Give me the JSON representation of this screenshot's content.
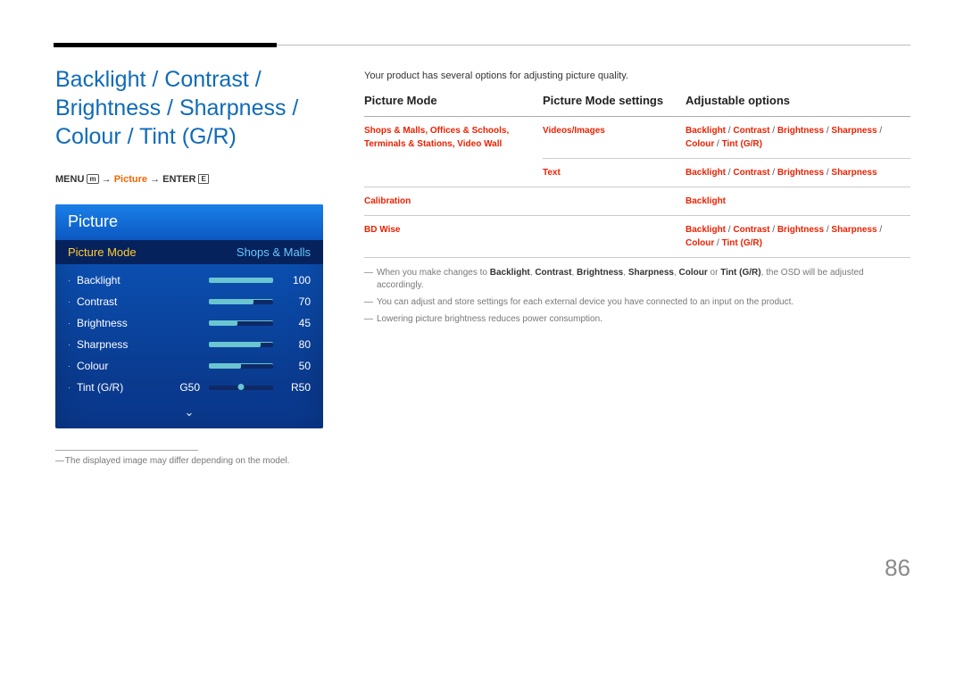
{
  "heading": "Backlight / Contrast / Brightness / Sharpness / Colour / Tint (G/R)",
  "path": {
    "menu": "MENU",
    "arrow": "→",
    "picture": "Picture",
    "enter": "ENTER",
    "menu_icon": "m",
    "enter_icon": "E"
  },
  "osd": {
    "title": "Picture",
    "mode_label": "Picture Mode",
    "mode_value": "Shops & Malls",
    "rows": [
      {
        "name": "Backlight",
        "value": "100",
        "pct": "p100"
      },
      {
        "name": "Contrast",
        "value": "70",
        "pct": "p70"
      },
      {
        "name": "Brightness",
        "value": "45",
        "pct": "p45"
      },
      {
        "name": "Sharpness",
        "value": "80",
        "pct": "p80"
      },
      {
        "name": "Colour",
        "value": "50",
        "pct": "p50"
      }
    ],
    "tint": {
      "name": "Tint (G/R)",
      "g": "G50",
      "r": "R50"
    },
    "more": "⌄"
  },
  "footnote_left": "The displayed image may differ depending on the model.",
  "intro": "Your product has several options for adjusting picture quality.",
  "columns": {
    "c1": "Picture Mode",
    "c2": "Picture Mode settings",
    "c3": "Adjustable options"
  },
  "table": [
    {
      "mode": "Shops & Malls, Offices & Schools, Terminals & Stations, Video Wall",
      "settings": "Videos/Images",
      "options": [
        "Backlight",
        "Contrast",
        "Brightness",
        "Sharpness",
        "Colour",
        "Tint (G/R)"
      ]
    },
    {
      "mode": "",
      "settings": "Text",
      "options": [
        "Backlight",
        "Contrast",
        "Brightness",
        "Sharpness"
      ]
    },
    {
      "mode": "Calibration",
      "settings": "",
      "options": [
        "Backlight"
      ]
    },
    {
      "mode": "BD Wise",
      "settings": "",
      "options": [
        "Backlight",
        "Contrast",
        "Brightness",
        "Sharpness",
        "Colour",
        "Tint (G/R)"
      ]
    }
  ],
  "notes": {
    "n1a": "When you make changes to ",
    "n1_bold": [
      "Backlight",
      "Contrast",
      "Brightness",
      "Sharpness",
      "Colour",
      "Tint (G/R)"
    ],
    "n1_join": ", ",
    "n1_or": " or ",
    "n1b": ", the OSD will be adjusted accordingly.",
    "n2": "You can adjust and store settings for each external device you have connected to an input on the product.",
    "n3": "Lowering picture brightness reduces power consumption."
  },
  "pageno": "86"
}
